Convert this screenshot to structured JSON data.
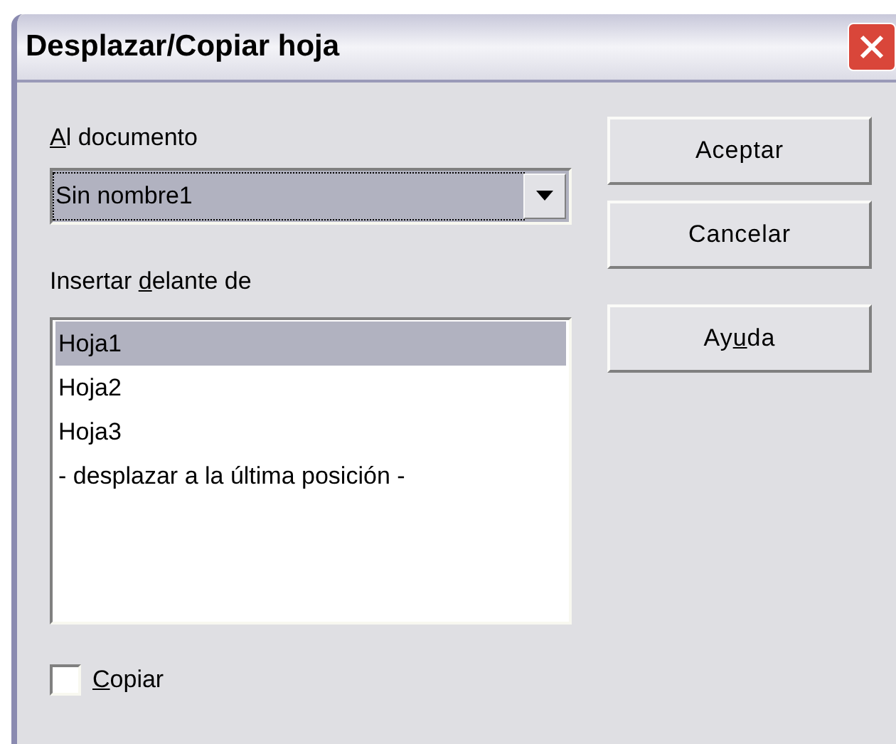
{
  "window": {
    "title": "Desplazar/Copiar hoja"
  },
  "document_label": {
    "key": "A",
    "after": "l documento"
  },
  "document_select": {
    "value": "Sin nombre1"
  },
  "insert_label": {
    "before": "Insertar ",
    "key": "d",
    "after": "elante de"
  },
  "sheets": [
    {
      "label": "Hoja1",
      "selected": true
    },
    {
      "label": "Hoja2",
      "selected": false
    },
    {
      "label": "Hoja3",
      "selected": false
    },
    {
      "label": "- desplazar a la última posición -",
      "selected": false
    }
  ],
  "copy": {
    "label": {
      "key": "C",
      "after": "opiar"
    },
    "checked": false
  },
  "buttons": [
    {
      "before": "Aceptar"
    },
    {
      "before": "Cancelar"
    },
    {
      "before": "Ay",
      "key": "u",
      "after": "da"
    }
  ]
}
